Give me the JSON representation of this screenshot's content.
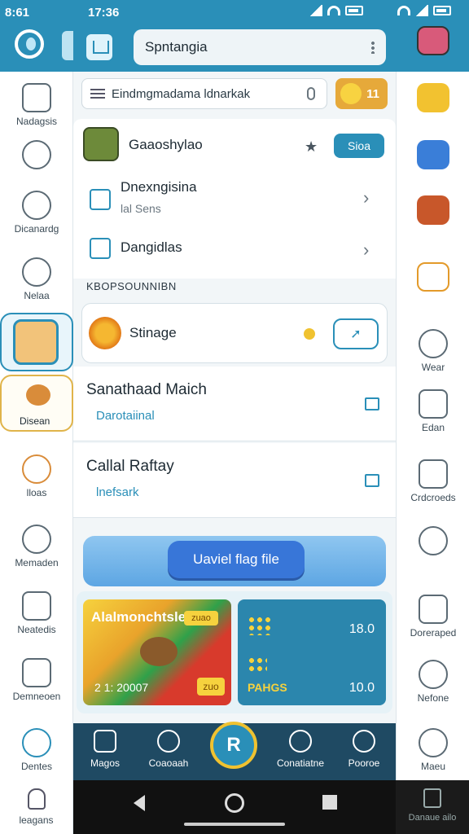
{
  "status": {
    "time_left": "8:61",
    "time_center": "17:36"
  },
  "header": {
    "title": "Spntangia"
  },
  "search": {
    "placeholder": "Eindmgmadama ldnarkak"
  },
  "coins": {
    "value": "11"
  },
  "game_row": {
    "title": "Gaaoshylao",
    "button": "Sioa"
  },
  "rows": [
    {
      "title": "Dnexngisina",
      "sub": "lal Sens"
    },
    {
      "title": "Dangidlas"
    }
  ],
  "section": {
    "label": "KBOPSOUNNIBN"
  },
  "storage": {
    "label": "Stinage"
  },
  "matches": [
    {
      "title": "Sanathaad Maich",
      "sub": "Darotaiinal"
    },
    {
      "title": "Callal Raftay",
      "sub": "lnefsark"
    }
  ],
  "primary": {
    "label": "Uaviel flag file"
  },
  "promo": {
    "left_title": "Alalmonchtsle",
    "left_tag": "zuao",
    "left_price": "2 1: 20007",
    "left_badge": "zuo",
    "right_val1": "18.0",
    "right_label": "PAHGS",
    "right_val2": "10.0"
  },
  "bottom_nav": [
    {
      "label": "Magos"
    },
    {
      "label": "Coaoaah"
    },
    {
      "label": "Conatiatne"
    },
    {
      "label": "Pooroe"
    }
  ],
  "left_rail": [
    {
      "label": "Nadagsis"
    },
    {
      "label": ""
    },
    {
      "label": "Dicanardg"
    },
    {
      "label": "Nelaa"
    },
    {
      "label": ""
    },
    {
      "label": "Disean"
    },
    {
      "label": "lloas"
    },
    {
      "label": "Memaden"
    },
    {
      "label": "Neatedis"
    },
    {
      "label": "Demneoen"
    },
    {
      "label": "Dentes"
    },
    {
      "label": "leagans"
    }
  ],
  "right_rail": [
    {
      "label": ""
    },
    {
      "label": ""
    },
    {
      "label": ""
    },
    {
      "label": ""
    },
    {
      "label": "Wear"
    },
    {
      "label": "Edan"
    },
    {
      "label": "Crdcroeds"
    },
    {
      "label": ""
    },
    {
      "label": "Doreraped"
    },
    {
      "label": "Nefone"
    },
    {
      "label": "Maeu"
    },
    {
      "label": "Danaue ailo"
    }
  ],
  "colors": {
    "accent": "#2a8fb8",
    "header": "#2a8fb8",
    "nav": "#1f4a63",
    "gold": "#f0c230"
  }
}
